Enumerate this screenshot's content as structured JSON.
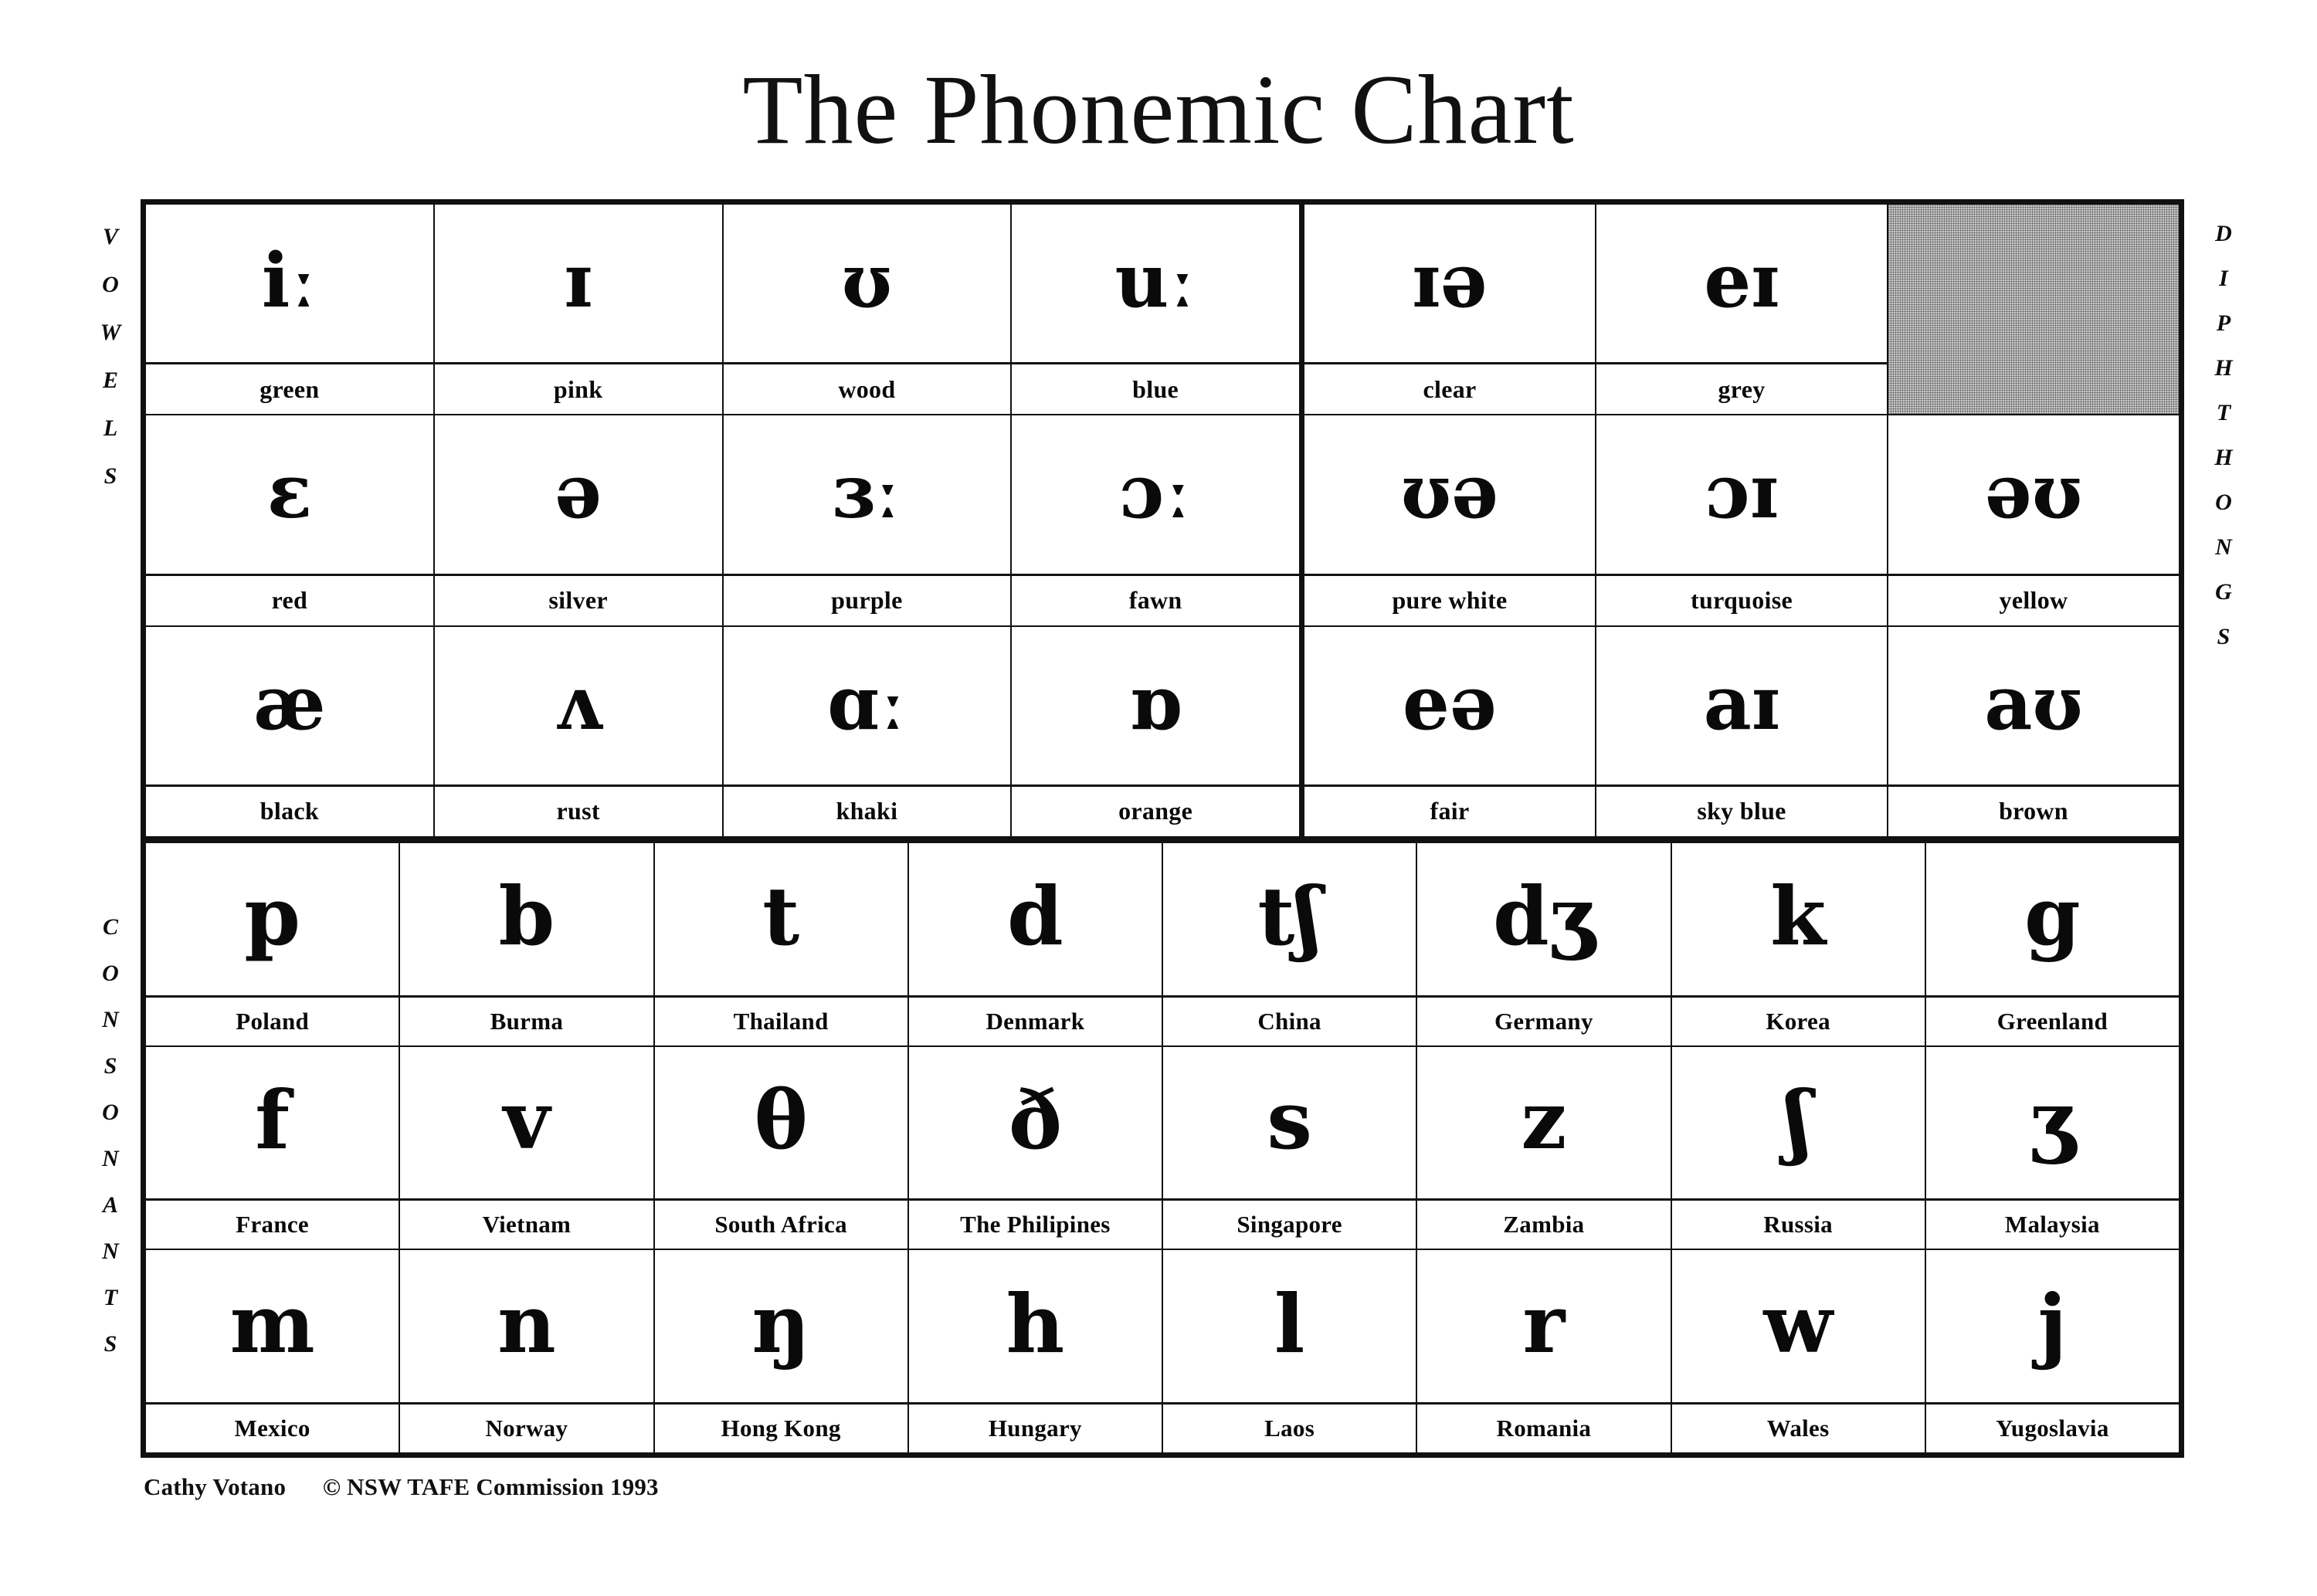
{
  "title": "The Phonemic Chart",
  "side_labels": {
    "vowels": "VOWELS",
    "consonants": "CONSONANTS",
    "diphthongs": "DIPHTHONGS"
  },
  "colors": {
    "ink": "#111111",
    "paper": "#ffffff",
    "shaded_cell": "#c9c9c9"
  },
  "vowels": {
    "rows": [
      [
        {
          "symbol": "iː",
          "word": "green"
        },
        {
          "symbol": "ɪ",
          "word": "pink"
        },
        {
          "symbol": "ʊ",
          "word": "wood"
        },
        {
          "symbol": "uː",
          "word": "blue"
        }
      ],
      [
        {
          "symbol": "ɛ",
          "word": "red"
        },
        {
          "symbol": "ə",
          "word": "silver"
        },
        {
          "symbol": "ɜː",
          "word": "purple"
        },
        {
          "symbol": "ɔː",
          "word": "fawn"
        }
      ],
      [
        {
          "symbol": "æ",
          "word": "black"
        },
        {
          "symbol": "ʌ",
          "word": "rust"
        },
        {
          "symbol": "ɑː",
          "word": "khaki"
        },
        {
          "symbol": "ɒ",
          "word": "orange"
        }
      ]
    ]
  },
  "diphthongs": {
    "rows": [
      [
        {
          "symbol": "ɪə",
          "word": "clear",
          "shaded": false
        },
        {
          "symbol": "eɪ",
          "word": "grey",
          "shaded": false
        },
        {
          "symbol": "",
          "word": "",
          "shaded": true
        }
      ],
      [
        {
          "symbol": "ʊə",
          "word": "pure white",
          "shaded": false
        },
        {
          "symbol": "ɔɪ",
          "word": "turquoise",
          "shaded": false
        },
        {
          "symbol": "əʊ",
          "word": "yellow",
          "shaded": false
        }
      ],
      [
        {
          "symbol": "eə",
          "word": "fair",
          "shaded": false
        },
        {
          "symbol": "aɪ",
          "word": "sky blue",
          "shaded": false
        },
        {
          "symbol": "aʊ",
          "word": "brown",
          "shaded": false
        }
      ]
    ]
  },
  "consonants": {
    "rows": [
      [
        {
          "symbol": "p",
          "word": "Poland"
        },
        {
          "symbol": "b",
          "word": "Burma"
        },
        {
          "symbol": "t",
          "word": "Thailand"
        },
        {
          "symbol": "d",
          "word": "Denmark"
        },
        {
          "symbol": "tʃ",
          "word": "China"
        },
        {
          "symbol": "dʒ",
          "word": "Germany"
        },
        {
          "symbol": "k",
          "word": "Korea"
        },
        {
          "symbol": "g",
          "word": "Greenland"
        }
      ],
      [
        {
          "symbol": "f",
          "word": "France"
        },
        {
          "symbol": "v",
          "word": "Vietnam"
        },
        {
          "symbol": "θ",
          "word": "South Africa"
        },
        {
          "symbol": "ð",
          "word": "The Philipines"
        },
        {
          "symbol": "s",
          "word": "Singapore"
        },
        {
          "symbol": "z",
          "word": "Zambia"
        },
        {
          "symbol": "ʃ",
          "word": "Russia"
        },
        {
          "symbol": "ʒ",
          "word": "Malaysia"
        }
      ],
      [
        {
          "symbol": "m",
          "word": "Mexico"
        },
        {
          "symbol": "n",
          "word": "Norway"
        },
        {
          "symbol": "ŋ",
          "word": "Hong Kong"
        },
        {
          "symbol": "h",
          "word": "Hungary"
        },
        {
          "symbol": "l",
          "word": "Laos"
        },
        {
          "symbol": "r",
          "word": "Romania"
        },
        {
          "symbol": "w",
          "word": "Wales"
        },
        {
          "symbol": "j",
          "word": "Yugoslavia"
        }
      ]
    ]
  },
  "footer": {
    "author": "Cathy Votano",
    "copyright": "© NSW TAFE Commission 1993",
    "full": "Cathy Votano      © NSW TAFE Commission 1993"
  }
}
